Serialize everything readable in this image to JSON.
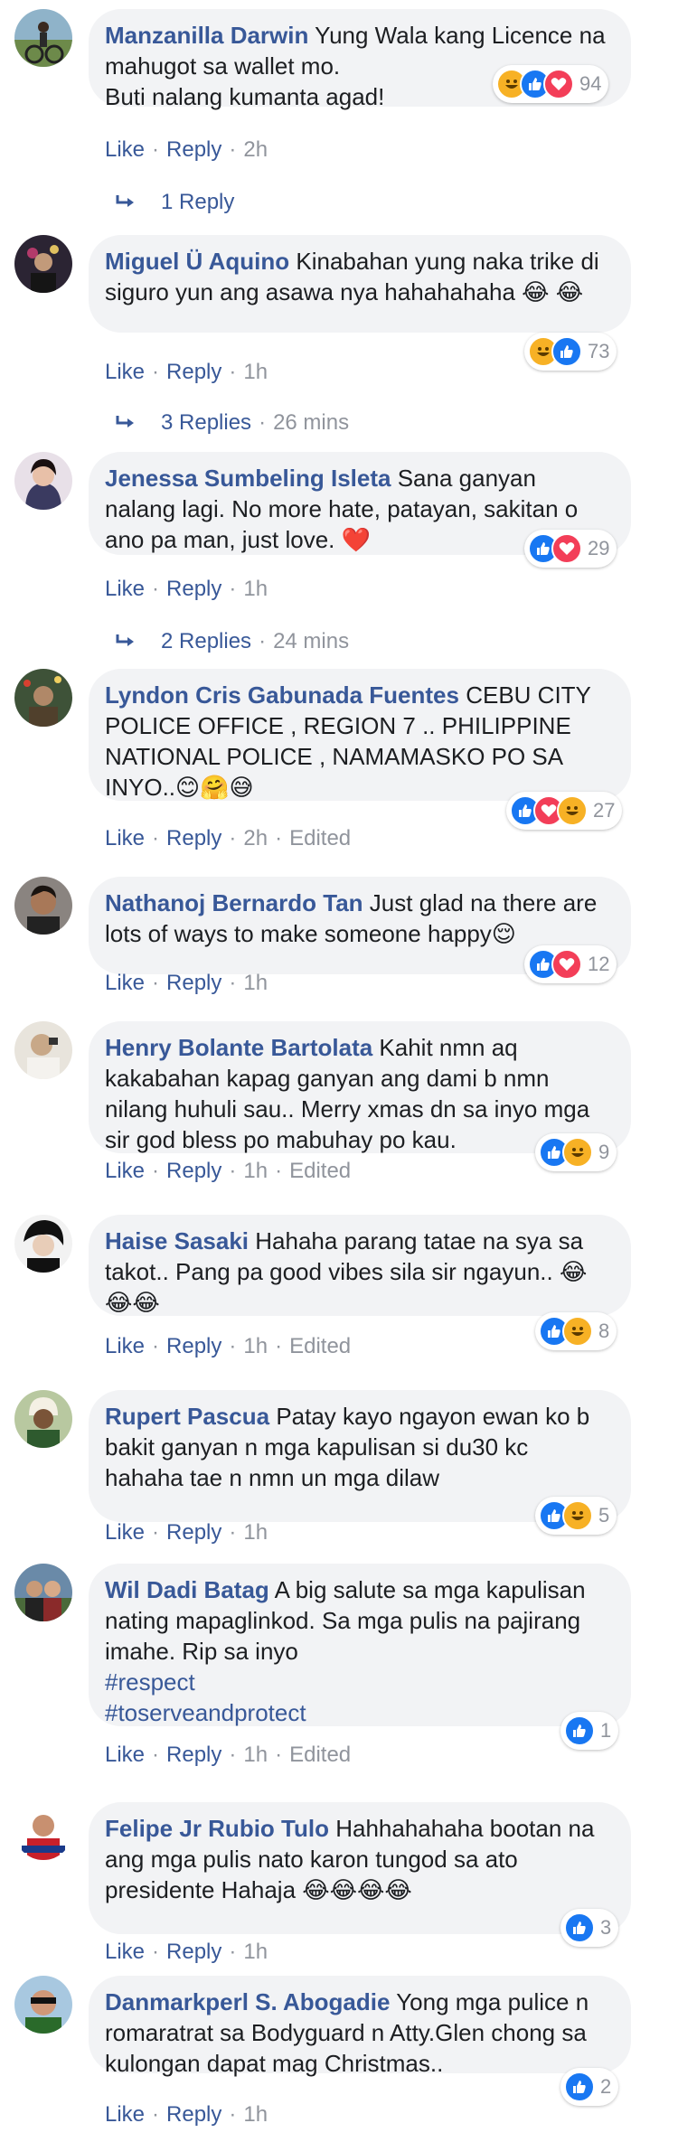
{
  "actions": {
    "like": "Like",
    "reply": "Reply",
    "edited": "Edited",
    "sep": "·"
  },
  "colors": {
    "link": "#385898",
    "bubble": "#f2f3f5",
    "like": "#1877f2",
    "love": "#f33e58",
    "haha": "#f7b125"
  },
  "comments": [
    {
      "author": "Manzanilla Darwin",
      "text": "Yung Wala kang Licence na mahugot sa wallet mo.\nButi nalang kumanta agad!",
      "time": "2h",
      "reactions": [
        "haha",
        "like",
        "love"
      ],
      "count": "94",
      "reply_label": "1 Reply",
      "reply_time": ""
    },
    {
      "author": "Miguel Ü Aquino",
      "text": "Kinabahan yung naka trike di siguro yun ang asawa nya hahahahaha 😂 😂",
      "time": "1h",
      "reactions": [
        "haha",
        "like"
      ],
      "count": "73",
      "reply_label": "3 Replies",
      "reply_time": "26 mins"
    },
    {
      "author": "Jenessa Sumbeling Isleta",
      "text": "Sana ganyan nalang lagi. No more hate, patayan, sakitan o ano pa man, just love. ❤️",
      "time": "1h",
      "reactions": [
        "like",
        "love"
      ],
      "count": "29",
      "reply_label": "2 Replies",
      "reply_time": "24 mins"
    },
    {
      "author": "Lyndon Cris Gabunada Fuentes",
      "text": "CEBU CITY POLICE OFFICE , REGION 7 .. PHILIPPINE NATIONAL POLICE , NAMAMASKO PO SA INYO..😊🤗😅",
      "time": "2h",
      "edited": true,
      "reactions": [
        "like",
        "love",
        "haha"
      ],
      "count": "27"
    },
    {
      "author": "Nathanoj Bernardo Tan",
      "text": "Just glad na there are lots of ways to make someone happy😌",
      "time": "1h",
      "reactions": [
        "like",
        "love"
      ],
      "count": "12"
    },
    {
      "author": "Henry Bolante Bartolata",
      "text": "Kahit nmn aq kakabahan kapag ganyan ang dami b nmn nilang huhuli sau.. Merry xmas dn sa inyo mga sir god bless po mabuhay po kau.",
      "time": "1h",
      "edited": true,
      "reactions": [
        "like",
        "haha"
      ],
      "count": "9"
    },
    {
      "author": "Haise Sasaki",
      "text": "Hahaha parang tatae na sya sa takot.. Pang pa good vibes sila sir ngayun.. 😂 😂😂",
      "time": "1h",
      "edited": true,
      "reactions": [
        "like",
        "haha"
      ],
      "count": "8"
    },
    {
      "author": "Rupert Pascua",
      "text": "Patay kayo ngayon ewan ko b bakit ganyan n mga kapulisan si du30 kc hahaha tae n nmn un mga dilaw",
      "time": "1h",
      "reactions": [
        "like",
        "haha"
      ],
      "count": "5"
    },
    {
      "author": "Wil Dadi Batag",
      "text": "A big salute sa mga kapulisan nating mapaglinkod. Sa mga pulis na pajirang imahe. Rip sa inyo",
      "tags": [
        "#respect",
        "#toserveandprotect"
      ],
      "time": "1h",
      "edited": true,
      "reactions": [
        "like"
      ],
      "count": "1"
    },
    {
      "author": "Felipe Jr Rubio Tulo",
      "text": "Hahhahahaha bootan na ang mga pulis nato karon tungod sa ato presidente Hahaja 😂😂😂😂",
      "time": "1h",
      "reactions": [
        "like"
      ],
      "count": "3"
    },
    {
      "author": "Danmarkperl S. Abogadie",
      "text": "Yong mga pulice n romaratrat sa Bodyguard n Atty.Glen chong sa kulongan dapat mag Christmas..",
      "time": "1h",
      "reactions": [
        "like"
      ],
      "count": "2"
    }
  ]
}
